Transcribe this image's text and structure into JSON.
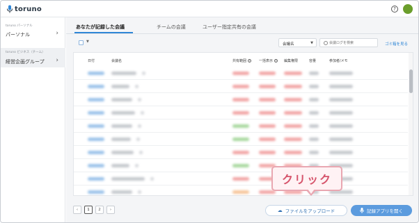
{
  "header": {
    "logo_text": "toruno",
    "help_icon": "question-circle-icon",
    "brand_color": "#2b3845",
    "avatar_color": "#6b9e2c"
  },
  "sidebar": {
    "groups": [
      {
        "sub": "toruno パーソナル",
        "main": "パーソナル"
      },
      {
        "sub": "toruno ビジネス（チーム）",
        "main": "経営企画グループ"
      }
    ]
  },
  "tabs": [
    {
      "label": "あなたが記録した会議"
    },
    {
      "label": "チームの会議"
    },
    {
      "label": "ユーザー指定共有の会議"
    }
  ],
  "toolbar": {
    "select_value": "会議名",
    "search_placeholder": "会議ログを検索",
    "trash_label": "ゴミ箱を見る"
  },
  "table": {
    "columns": [
      "日付",
      "会議名",
      "共有範囲",
      "一括表示",
      "編集権限",
      "容量",
      "参加者/メモ"
    ]
  },
  "pagination": {
    "pages": [
      "1",
      "2"
    ],
    "current": "1"
  },
  "actions": {
    "upload_label": "ファイルをアップロード",
    "record_label": "記録アプリを開く"
  },
  "callout": {
    "text": "クリック"
  },
  "colors": {
    "accent": "#2f86d6",
    "record_button": "#5b9bde",
    "callout_border": "#e9a7b1",
    "callout_text": "#d6546b"
  }
}
